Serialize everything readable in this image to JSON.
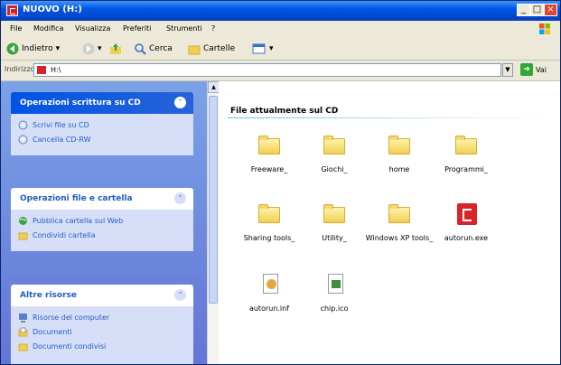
{
  "window": {
    "title": "NUOVO (H:)"
  },
  "titlebar_buttons": [
    "_",
    "□",
    "×"
  ],
  "menu": [
    "File",
    "Modifica",
    "Visualizza",
    "Preferiti",
    "Strumenti",
    "?"
  ],
  "toolbar": {
    "back": "Indietro",
    "search": "Cerca",
    "folders": "Cartelle"
  },
  "address": {
    "label": "Indirizzo",
    "value": "H:\\",
    "go": "Vai"
  },
  "taskpane": {
    "panels": [
      {
        "title": "Operazioni scrittura su CD",
        "items": [
          "Scrivi file su CD",
          "Cancella CD-RW"
        ]
      },
      {
        "title": "Operazioni file e cartella",
        "items": [
          "Pubblica cartella sul Web",
          "Condividi cartella"
        ]
      },
      {
        "title": "Altre risorse",
        "items": [
          "Risorse del computer",
          "Documenti",
          "Documenti condivisi"
        ]
      }
    ]
  },
  "files_section": {
    "title": "File attualmente sul CD"
  },
  "files": [
    {
      "name": "Freeware_",
      "icon": "folder-icon"
    },
    {
      "name": "Giochi_",
      "icon": "folder-icon"
    },
    {
      "name": "home",
      "icon": "folder-icon"
    },
    {
      "name": "Programmi_",
      "icon": "folder-icon"
    },
    {
      "name": "Sharing tools_",
      "icon": "folder-icon"
    },
    {
      "name": "Utility_",
      "icon": "folder-icon"
    },
    {
      "name": "Windows XP tools_",
      "icon": "folder-icon"
    },
    {
      "name": "autorun.exe",
      "icon": "exe-icon"
    },
    {
      "name": "autorun.inf",
      "icon": "inf-file-icon"
    },
    {
      "name": "chip.ico",
      "icon": "ico-file-icon"
    }
  ]
}
